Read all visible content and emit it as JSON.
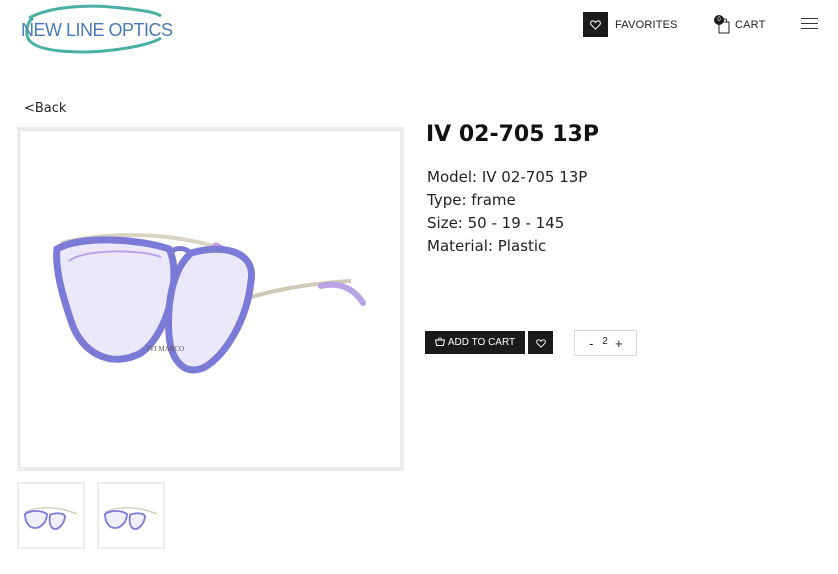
{
  "header": {
    "logo_text": "NEW LINE OPTICS",
    "favorites_label": "FAVORITES",
    "cart_label": "CART",
    "cart_count": "0",
    "menu_icon": "hamburger-icon",
    "brand_color": "#4a79b8",
    "accent_color": "#1b1b1b"
  },
  "nav": {
    "back_label": "<Back"
  },
  "product": {
    "title": "IV 02-705 13P",
    "specs": {
      "model": "Model: IV 02-705 13P",
      "type": "Type: frame",
      "size": "Size: 50 - 19 - 145",
      "material": "Material: Plastic"
    },
    "image_watermark": "IVI MARCO",
    "frame_colors": {
      "rim": "#7b7ad6",
      "rim_light": "#b9a3e6",
      "temple": "#cfc9b8",
      "tip": "#c79ad8"
    }
  },
  "actions": {
    "add_to_cart_label": "ADD TO CART",
    "add_to_cart_icon": "basket-icon",
    "wishlist_icon": "heart-icon"
  },
  "quantity": {
    "minus_label": "-",
    "value": "2",
    "plus_label": "+"
  }
}
